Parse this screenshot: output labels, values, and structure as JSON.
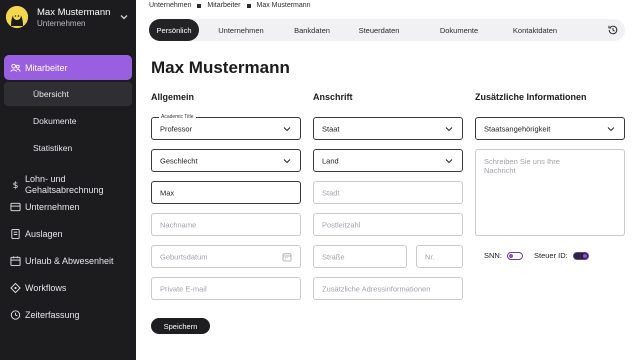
{
  "profile": {
    "name": "Max Mustermann",
    "company": "Unternehmen"
  },
  "sidebar": {
    "items": [
      {
        "label": "Mitarbeiter",
        "icon": "people-icon",
        "active": true
      },
      {
        "label": "Übersicht",
        "sub": true,
        "active": true
      },
      {
        "label": "Dokumente",
        "sub": true
      },
      {
        "label": "Statistiken",
        "sub": true
      },
      {
        "label_line1": "Lohn- und",
        "label_line2": "Gehaltsabrechnung",
        "icon": "dollar-icon"
      },
      {
        "label": "Unternehmen",
        "icon": "building-icon"
      },
      {
        "label": "Auslagen",
        "icon": "receipt-icon"
      },
      {
        "label": "Urlaub & Abwesenheit",
        "icon": "calendar-icon"
      },
      {
        "label": "Workflows",
        "icon": "workflow-icon"
      },
      {
        "label": "Zeiterfassung",
        "icon": "clock-icon"
      }
    ]
  },
  "breadcrumb": [
    "Unternehmen",
    "Mitarbeiter",
    "Max Mustermann"
  ],
  "tabs": [
    "Persönlich",
    "Unternehmen",
    "Bankdaten",
    "Steuerdaten",
    "Dokumente",
    "Kontaktdaten"
  ],
  "page_title": "Max Mustermann",
  "sections": {
    "general": {
      "heading": "Allgemein",
      "title_label": "Academic Title",
      "title_value": "Professor",
      "gender_value": "Geschlecht",
      "first_name_value": "Max",
      "last_name_placeholder": "Nachname",
      "birthdate_placeholder": "Geburtsdatum",
      "email_placeholder": "Private E-mail"
    },
    "address": {
      "heading": "Anschrift",
      "country_value": "Staat",
      "state_value": "Land",
      "city_placeholder": "Stadt",
      "zip_placeholder": "Postleitzahl",
      "street_placeholder": "Straße",
      "number_placeholder": "Nr.",
      "extra_placeholder": "Zusätzliche Adressinformationen"
    },
    "additional": {
      "heading": "Zusätzliche Informationen",
      "nationality_value": "Staatsangehörigkeit",
      "message_placeholder": "Schreiben Sie uns Ihre Nachricht",
      "ssn_label": "SNN:",
      "ssn_on": false,
      "tax_label": "Steuer ID:",
      "tax_on": true
    }
  },
  "save_label": "Speichern",
  "colors": {
    "accent": "#9a5ee0",
    "sidebar_bg": "#1c1c1f",
    "dark": "#1e1e21"
  }
}
